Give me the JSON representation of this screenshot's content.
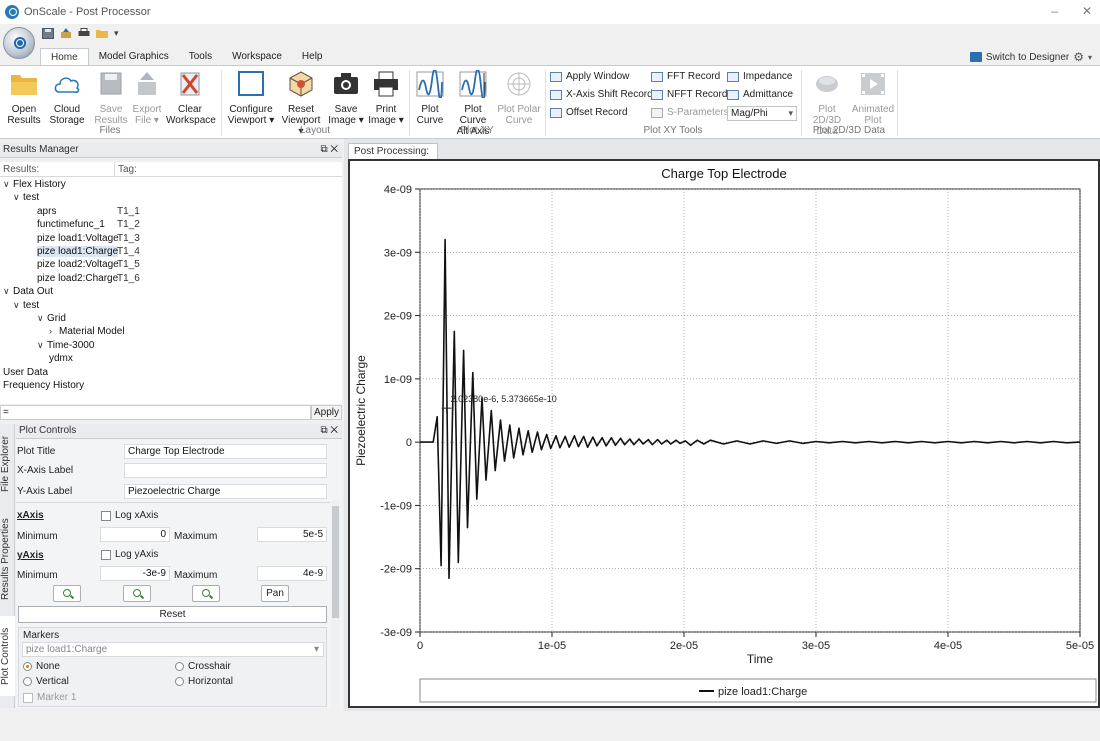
{
  "window": {
    "title": "OnScale - Post Processor",
    "minimize": "–",
    "close": "✕"
  },
  "tabs": [
    "Home",
    "Model Graphics",
    "Tools",
    "Workspace",
    "Help"
  ],
  "switch_label": "Switch to Designer",
  "ribbon": {
    "files": {
      "label": "Files",
      "open": "Open\nResults",
      "cloud": "Cloud\nStorage",
      "save": "Save\nResults",
      "export": "Export\nFile ▾",
      "clear": "Clear\nWorkspace"
    },
    "layout": {
      "label": "Layout",
      "configure": "Configure\nViewport ▾",
      "reset": "Reset\nViewport ▾",
      "save_image": "Save\nImage ▾",
      "print_image": "Print\nImage ▾"
    },
    "plotxy": {
      "label": "Plot XY",
      "plot_curve": "Plot\nCurve",
      "alt_axis": "Plot Curve\nAlt Axis",
      "polar": "Plot Polar\nCurve"
    },
    "tools": {
      "label": "Plot XY Tools",
      "apply_window": "Apply Window",
      "x_shift": "X-Axis Shift Record",
      "offset": "Offset Record",
      "fft": "FFT Record",
      "nfft": "NFFT Record",
      "sparams": "S-Parameters",
      "impedance": "Impedance",
      "admittance": "Admittance",
      "magphi": "Mag/Phi"
    },
    "plot2d3d": {
      "label": "Plot 2D/3D Data",
      "data": "Plot 2D/3D\nData",
      "animated": "Animated\nPlot"
    }
  },
  "results_manager": {
    "title": "Results Manager",
    "col_results": "Results:",
    "col_tags": "Tag:",
    "tree": [
      {
        "label": "Flex History",
        "arrow": "∨",
        "level": 0
      },
      {
        "label": "test",
        "arrow": "∨",
        "level": 1
      },
      {
        "label": "aprs",
        "tag": "T1_1",
        "level": 2
      },
      {
        "label": "functimefunc_1",
        "tag": "T1_2",
        "level": 2
      },
      {
        "label": "pize load1:Voltage",
        "tag": "T1_3",
        "level": 2
      },
      {
        "label": "pize load1:Charge",
        "tag": "T1_4",
        "level": 2,
        "selected": true
      },
      {
        "label": "pize load2:Voltage",
        "tag": "T1_5",
        "level": 2
      },
      {
        "label": "pize load2:Charge",
        "tag": "T1_6",
        "level": 2
      },
      {
        "label": "Data Out",
        "arrow": "∨",
        "level": 0
      },
      {
        "label": "test",
        "arrow": "∨",
        "level": 1
      },
      {
        "label": "Grid",
        "arrow": "∨",
        "level": 2
      },
      {
        "label": "Material Model",
        "arrow": "›",
        "level": 3
      },
      {
        "label": "Time-3000",
        "arrow": "∨",
        "level": 2
      },
      {
        "label": "ydmx",
        "level": 3
      },
      {
        "label": "User Data",
        "level": 0
      },
      {
        "label": "Frequency History",
        "level": 0
      }
    ],
    "filter_value": "=",
    "apply": "Apply"
  },
  "side_tabs": [
    "File Explorer",
    "Results Properties",
    "Plot Controls"
  ],
  "plot_controls": {
    "title": "Plot Controls",
    "plot_title_label": "Plot Title",
    "plot_title": "Charge Top Electrode",
    "x_label_label": "X-Axis Label",
    "x_label": "",
    "y_label_label": "Y-Axis Label",
    "y_label": "Piezoelectric Charge",
    "xaxis": "xAxis",
    "log_x": "Log xAxis",
    "yaxis": "yAxis",
    "log_y": "Log yAxis",
    "minimum": "Minimum",
    "maximum": "Maximum",
    "x_min": "0",
    "x_max": "5e-5",
    "y_min": "-3e-9",
    "y_max": "4e-9",
    "pan": "Pan",
    "reset": "Reset",
    "markers": "Markers",
    "marker_curve": "pize load1:Charge",
    "none": "None",
    "crosshair": "Crosshair",
    "vertical": "Vertical",
    "horizontal": "Horizontal",
    "marker1": "Marker 1"
  },
  "doc_tab": "Post Processing:",
  "chart_data": {
    "type": "line",
    "title": "Charge Top Electrode",
    "xlabel": "Time",
    "ylabel": "Piezoelectric Charge",
    "xlim": [
      0,
      5e-05
    ],
    "ylim": [
      -3e-09,
      4e-09
    ],
    "x_ticks": [
      "0",
      "1e-05",
      "2e-05",
      "3e-05",
      "4e-05",
      "5e-05"
    ],
    "x_tick_values": [
      0,
      1e-05,
      2e-05,
      3e-05,
      4e-05,
      5e-05
    ],
    "y_ticks": [
      "4e-09",
      "3e-09",
      "2e-09",
      "1e-09",
      "0",
      "-1e-09",
      "-2e-09",
      "-3e-09"
    ],
    "y_tick_values": [
      4e-09,
      3e-09,
      2e-09,
      1e-09,
      0,
      -1e-09,
      -2e-09,
      -3e-09
    ],
    "grid": true,
    "legend": "bottom",
    "annotation": {
      "text": "2.02380e-6, 5.373665e-10",
      "x": 2.02e-06,
      "y": 5.37e-10
    },
    "series": [
      {
        "name": "pize load1:Charge",
        "x": [
          0,
          1e-06,
          1.3e-06,
          1.6e-06,
          1.9e-06,
          2.2e-06,
          2.6e-06,
          2.9e-06,
          3.3e-06,
          3.6e-06,
          4e-06,
          4.3e-06,
          4.7e-06,
          5e-06,
          5.4e-06,
          5.7e-06,
          6.1e-06,
          6.4e-06,
          6.8e-06,
          7.1e-06,
          7.5e-06,
          7.8e-06,
          8.2e-06,
          8.5e-06,
          8.9e-06,
          9.2e-06,
          9.6e-06,
          9.9e-06,
          1.03e-05,
          1.06e-05,
          1.1e-05,
          1.13e-05,
          1.17e-05,
          1.2e-05,
          1.24e-05,
          1.27e-05,
          1.31e-05,
          1.34e-05,
          1.38e-05,
          1.41e-05,
          1.45e-05,
          1.48e-05,
          1.52e-05,
          1.55e-05,
          1.59e-05,
          1.62e-05,
          1.66e-05,
          1.69e-05,
          1.73e-05,
          1.76e-05,
          1.8e-05,
          1.83e-05,
          1.87e-05,
          1.9e-05,
          1.94e-05,
          1.97e-05,
          2.01e-05,
          2.05e-05,
          2.1e-05,
          2.15e-05,
          2.2e-05,
          2.3e-05,
          2.4e-05,
          2.5e-05,
          2.6e-05,
          2.7e-05,
          2.8e-05,
          2.9e-05,
          3e-05,
          3.1e-05,
          3.2e-05,
          3.3e-05,
          3.4e-05,
          3.5e-05,
          3.6e-05,
          3.7e-05,
          3.8e-05,
          3.9e-05,
          4e-05,
          4.1e-05,
          4.2e-05,
          4.3e-05,
          4.4e-05,
          4.5e-05,
          4.6e-05,
          4.7e-05,
          4.8e-05,
          4.9e-05,
          5e-05
        ],
        "y": [
          0,
          0,
          4e-10,
          -1.95e-09,
          3.2e-09,
          -2.15e-09,
          1.75e-09,
          -1.9e-09,
          1.45e-09,
          -1.35e-09,
          1.1e-09,
          -9e-10,
          7e-10,
          -6e-10,
          5e-10,
          -4.5e-10,
          3.5e-10,
          -3e-10,
          2.7e-10,
          -2.5e-10,
          2.2e-10,
          -2e-10,
          1.8e-10,
          -1.6e-10,
          1.6e-10,
          -1.2e-10,
          1.2e-10,
          -1e-10,
          1e-10,
          -9e-11,
          9e-11,
          -8e-11,
          1e-10,
          -7e-11,
          9e-11,
          -8e-11,
          8e-11,
          -6e-11,
          7e-11,
          -6e-11,
          7e-11,
          -5e-11,
          6e-11,
          -4e-11,
          5e-11,
          -4e-11,
          5e-11,
          -3e-11,
          4e-11,
          -4e-11,
          4e-11,
          -3e-11,
          3e-11,
          -3e-11,
          3e-11,
          -2e-11,
          2e-11,
          -5e-11,
          3e-11,
          -3e-11,
          3e-11,
          -3e-11,
          2e-11,
          -3e-11,
          2e-11,
          -2e-11,
          2e-11,
          -2e-11,
          1e-11,
          -1e-11,
          1e-11,
          -1e-11,
          1e-11,
          -1e-11,
          1e-11,
          -1e-11,
          1e-11,
          -1e-11,
          1e-11,
          -1e-11,
          1e-11,
          -1e-11,
          1e-11,
          -1e-11,
          1e-11,
          -1e-11,
          1e-11,
          -1e-11,
          0
        ]
      }
    ]
  }
}
